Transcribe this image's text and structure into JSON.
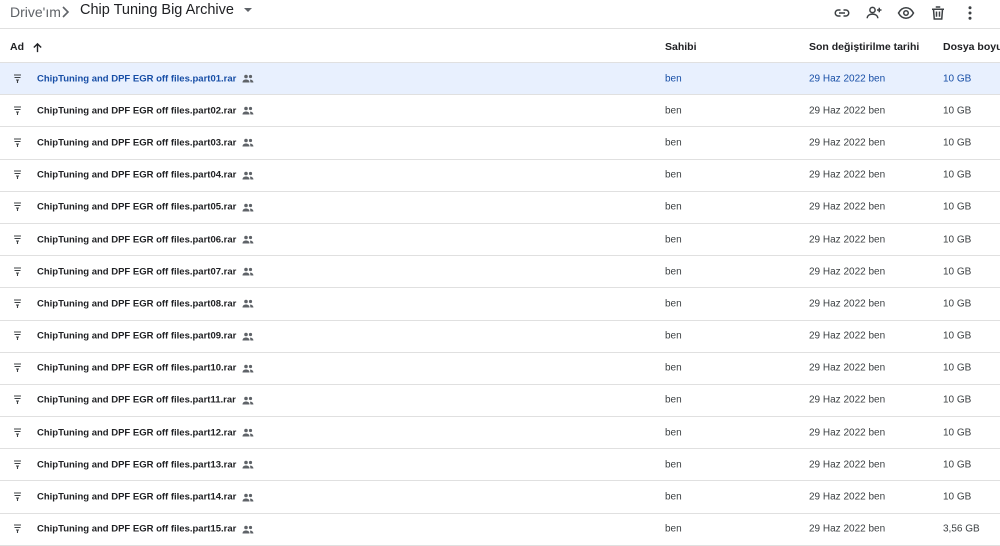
{
  "breadcrumb": {
    "root": "Drive'ım",
    "current": "Chip Tuning Big Archive"
  },
  "toolbar": {
    "icons": [
      "link-icon",
      "add-person-icon",
      "eye-icon",
      "trash-icon",
      "more-vert-icon"
    ]
  },
  "columns": {
    "name": "Ad",
    "owner": "Sahibi",
    "modified": "Son değiştirilme tarihi",
    "size": "Dosya boyutu"
  },
  "files": [
    {
      "name": "ChipTuning and DPF EGR off files.part01.rar",
      "owner": "ben",
      "modified": "29 Haz 2022 ben",
      "size": "10 GB"
    },
    {
      "name": "ChipTuning and DPF EGR off files.part02.rar",
      "owner": "ben",
      "modified": "29 Haz 2022 ben",
      "size": "10 GB"
    },
    {
      "name": "ChipTuning and DPF EGR off files.part03.rar",
      "owner": "ben",
      "modified": "29 Haz 2022 ben",
      "size": "10 GB"
    },
    {
      "name": "ChipTuning and DPF EGR off files.part04.rar",
      "owner": "ben",
      "modified": "29 Haz 2022 ben",
      "size": "10 GB"
    },
    {
      "name": "ChipTuning and DPF EGR off files.part05.rar",
      "owner": "ben",
      "modified": "29 Haz 2022 ben",
      "size": "10 GB"
    },
    {
      "name": "ChipTuning and DPF EGR off files.part06.rar",
      "owner": "ben",
      "modified": "29 Haz 2022 ben",
      "size": "10 GB"
    },
    {
      "name": "ChipTuning and DPF EGR off files.part07.rar",
      "owner": "ben",
      "modified": "29 Haz 2022 ben",
      "size": "10 GB"
    },
    {
      "name": "ChipTuning and DPF EGR off files.part08.rar",
      "owner": "ben",
      "modified": "29 Haz 2022 ben",
      "size": "10 GB"
    },
    {
      "name": "ChipTuning and DPF EGR off files.part09.rar",
      "owner": "ben",
      "modified": "29 Haz 2022 ben",
      "size": "10 GB"
    },
    {
      "name": "ChipTuning and DPF EGR off files.part10.rar",
      "owner": "ben",
      "modified": "29 Haz 2022 ben",
      "size": "10 GB"
    },
    {
      "name": "ChipTuning and DPF EGR off files.part11.rar",
      "owner": "ben",
      "modified": "29 Haz 2022 ben",
      "size": "10 GB"
    },
    {
      "name": "ChipTuning and DPF EGR off files.part12.rar",
      "owner": "ben",
      "modified": "29 Haz 2022 ben",
      "size": "10 GB"
    },
    {
      "name": "ChipTuning and DPF EGR off files.part13.rar",
      "owner": "ben",
      "modified": "29 Haz 2022 ben",
      "size": "10 GB"
    },
    {
      "name": "ChipTuning and DPF EGR off files.part14.rar",
      "owner": "ben",
      "modified": "29 Haz 2022 ben",
      "size": "10 GB"
    },
    {
      "name": "ChipTuning and DPF EGR off files.part15.rar",
      "owner": "ben",
      "modified": "29 Haz 2022 ben",
      "size": "3,56 GB"
    }
  ],
  "selected_index": 0,
  "colors": {
    "selected_bg": "#e8f0fe",
    "selected_text": "#174ea6",
    "divider": "#e0e0e0"
  }
}
